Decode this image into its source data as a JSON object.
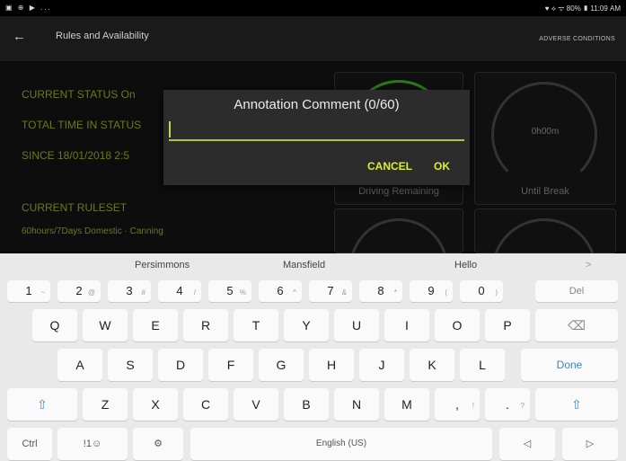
{
  "status_bar": {
    "left": "▣ ⊕ ▶ ...",
    "right": "♥ ⟡ ᯤ 80% ▮ 11:09 AM"
  },
  "app_bar": {
    "back_icon": "←",
    "title": "Rules and Availability",
    "action": "ADVERSE CONDITIONS"
  },
  "status": {
    "current_status": "CURRENT STATUS   On",
    "total_time": "TOTAL TIME IN STATUS",
    "since": "SINCE   18/01/2018 2:5",
    "current_ruleset": "CURRENT RULESET",
    "ruleset_value": "60hours/7Days Domestic · Canning"
  },
  "cards": [
    {
      "caption": "Driving Remaining",
      "value": ""
    },
    {
      "caption": "Until Break",
      "value": "0h00m"
    }
  ],
  "dialog": {
    "title": "Annotation Comment (0/60)",
    "cancel": "CANCEL",
    "ok": "OK"
  },
  "keyboard": {
    "suggestions": [
      "Persimmons",
      "Mansfield",
      "Hello",
      ">"
    ],
    "num_row": [
      {
        "k": "1",
        "s": "~"
      },
      {
        "k": "2",
        "s": "@"
      },
      {
        "k": "3",
        "s": "#"
      },
      {
        "k": "4",
        "s": "/"
      },
      {
        "k": "5",
        "s": "%"
      },
      {
        "k": "6",
        "s": "^"
      },
      {
        "k": "7",
        "s": "&"
      },
      {
        "k": "8",
        "s": "*"
      },
      {
        "k": "9",
        "s": "("
      },
      {
        "k": "0",
        "s": ")"
      },
      {
        "k": "Del",
        "s": ""
      }
    ],
    "row1": [
      "Q",
      "W",
      "E",
      "R",
      "T",
      "Y",
      "U",
      "I",
      "O",
      "P",
      "⌫"
    ],
    "row2": [
      "A",
      "S",
      "D",
      "F",
      "G",
      "H",
      "J",
      "K",
      "L",
      "Done"
    ],
    "row3": [
      "⇧",
      "Z",
      "X",
      "C",
      "V",
      "B",
      "N",
      "M",
      ",",
      ".",
      " ⇧"
    ],
    "row3_subs": {
      "comma": "!",
      "period": "?"
    },
    "bottom": {
      "ctrl": "Ctrl",
      "sym": "!1☺",
      "settings": "⚙",
      "space": "English (US)",
      "left": "◁",
      "right": "▷"
    }
  }
}
